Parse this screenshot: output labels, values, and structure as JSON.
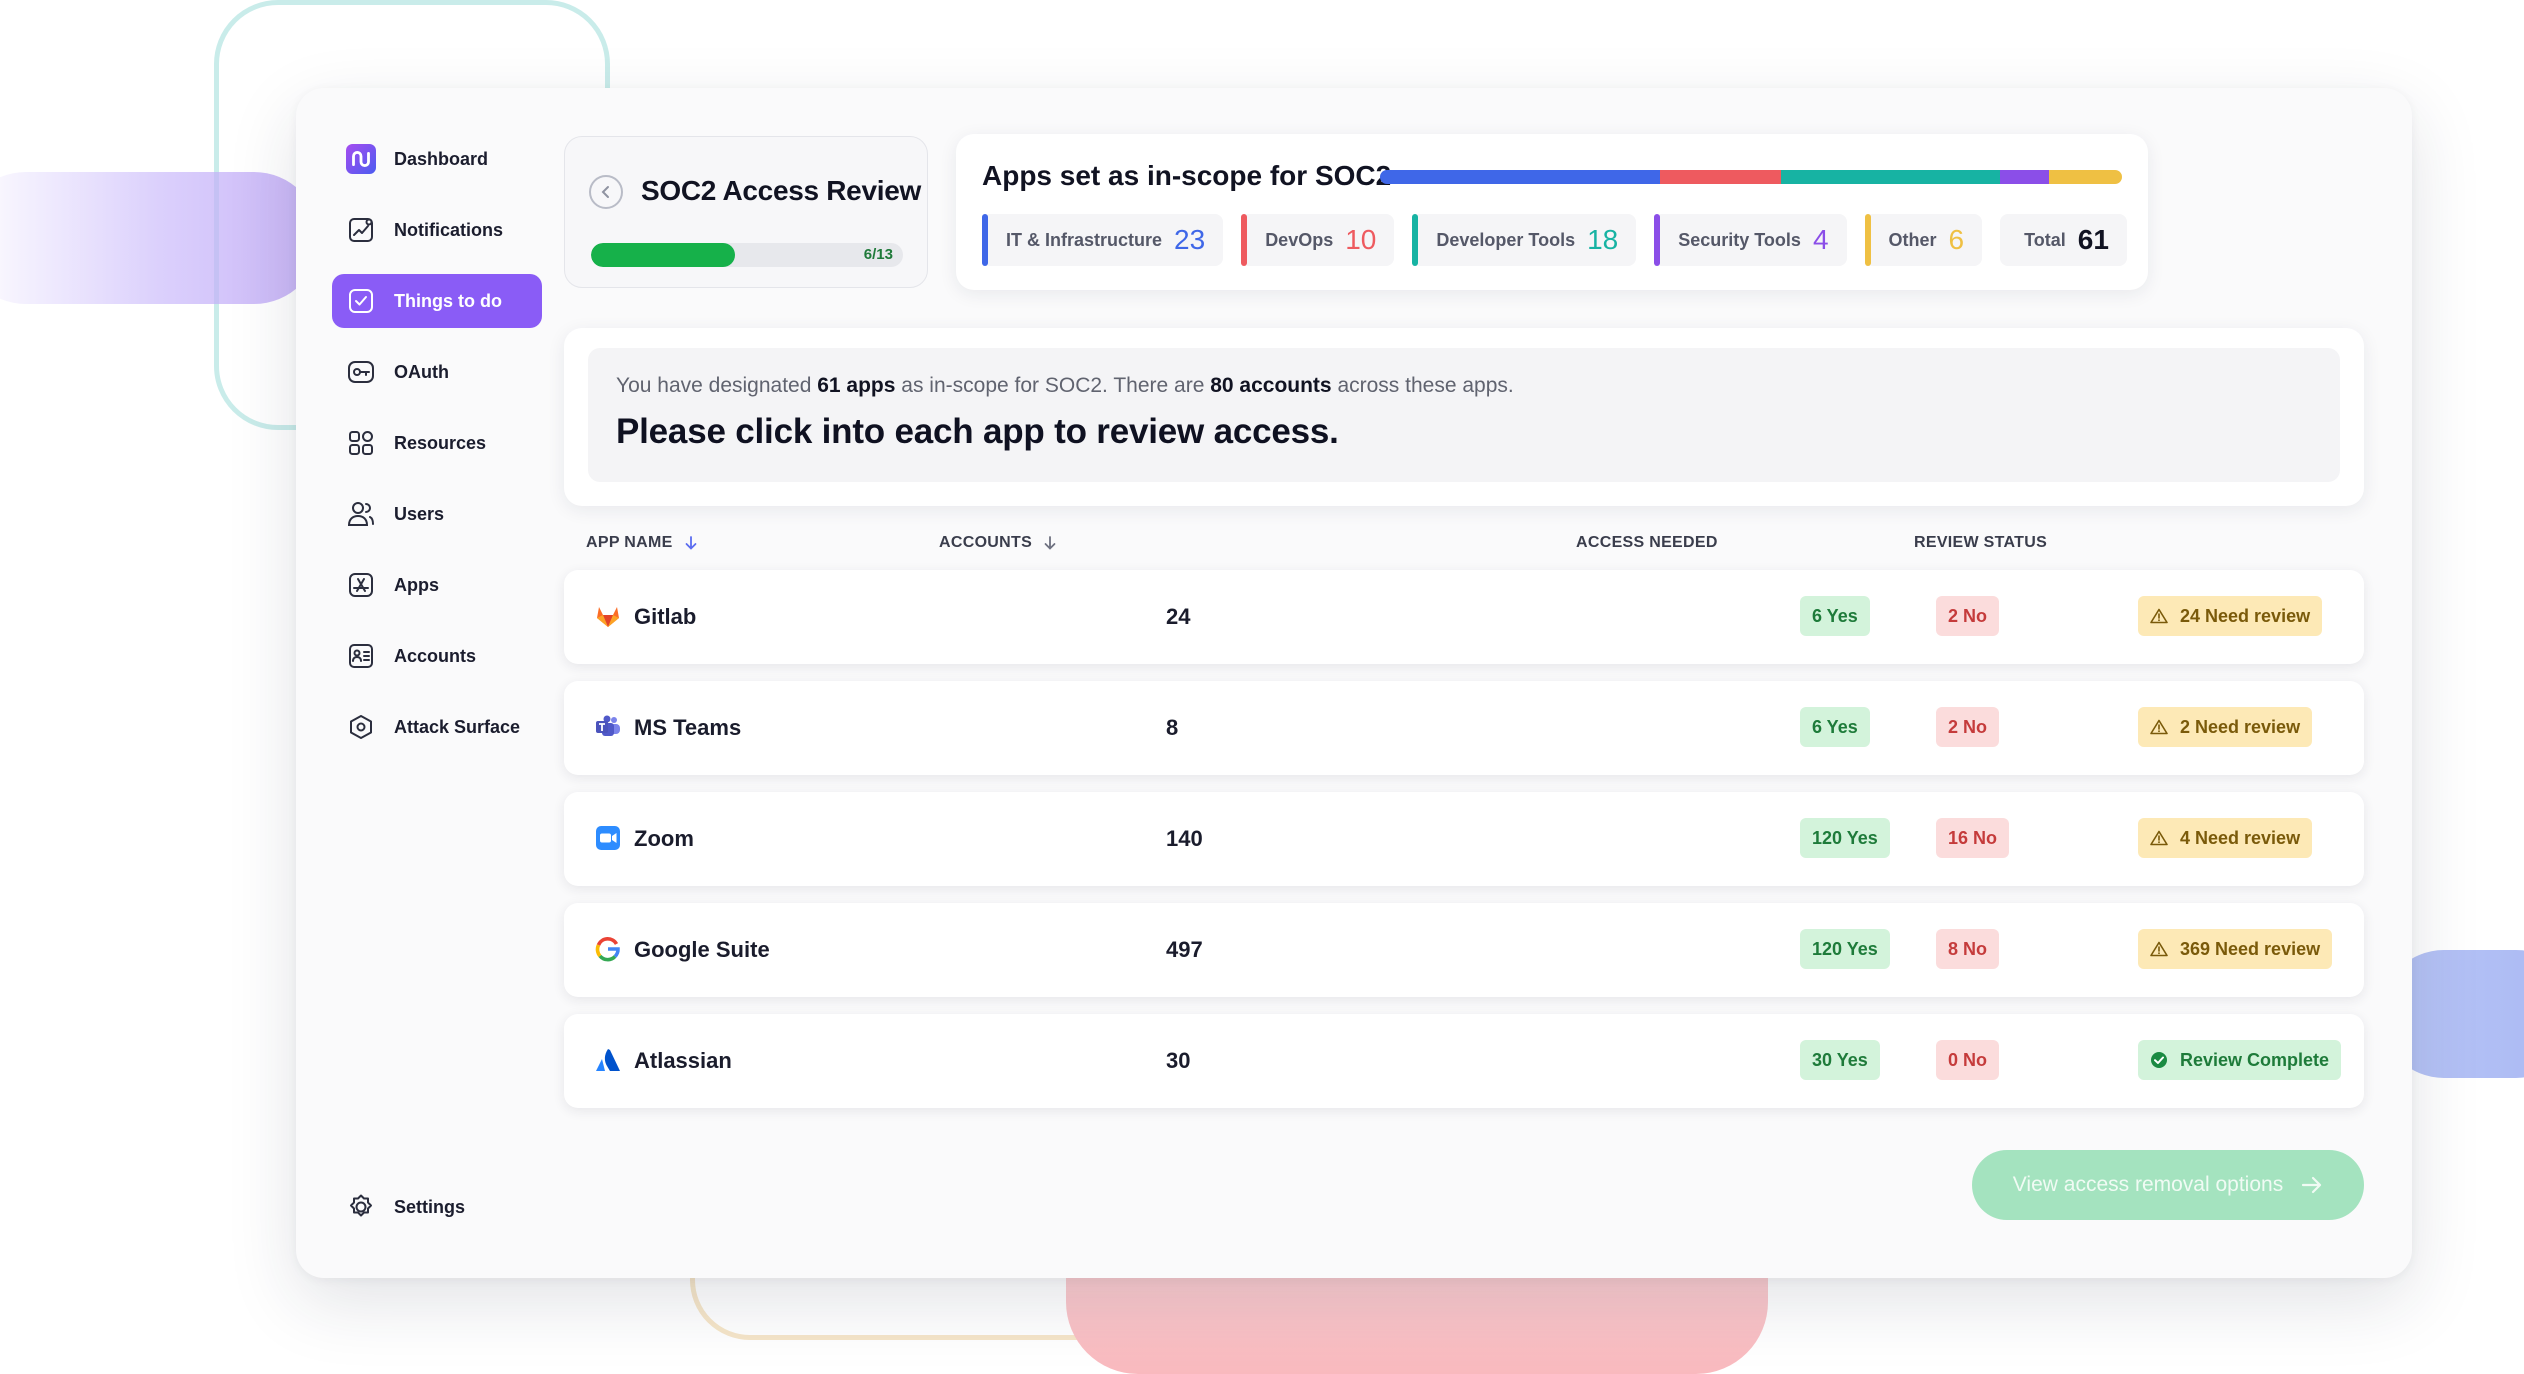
{
  "sidebar": {
    "items": [
      {
        "label": "Dashboard",
        "icon": "logo-icon"
      },
      {
        "label": "Notifications",
        "icon": "chart-line-icon"
      },
      {
        "label": "Things to do",
        "icon": "checkbox-icon",
        "active": true
      },
      {
        "label": "OAuth",
        "icon": "key-icon"
      },
      {
        "label": "Resources",
        "icon": "grid-icon"
      },
      {
        "label": "Users",
        "icon": "users-icon"
      },
      {
        "label": "Apps",
        "icon": "app-store-icon"
      },
      {
        "label": "Accounts",
        "icon": "id-card-icon"
      },
      {
        "label": "Attack Surface",
        "icon": "hexagon-icon"
      }
    ],
    "settings_label": "Settings"
  },
  "review": {
    "title": "SOC2 Access Review",
    "progress_text": "6/13",
    "progress_completed": 6,
    "progress_total": 13
  },
  "scope": {
    "title": "Apps set as in-scope for SOC2",
    "categories": [
      {
        "label": "IT & Infrastructure",
        "count": "23",
        "color": "#3f67e8"
      },
      {
        "label": "DevOps",
        "count": "10",
        "color": "#ee5a5f"
      },
      {
        "label": "Developer Tools",
        "count": "18",
        "color": "#17b3a3"
      },
      {
        "label": "Security Tools",
        "count": "4",
        "color": "#8b4ee8"
      },
      {
        "label": "Other",
        "count": "6",
        "color": "#efc043"
      }
    ],
    "total_label": "Total",
    "total_count": "61"
  },
  "info": {
    "pre1": "You have designated ",
    "apps": "61 apps",
    "mid": " as in-scope for SOC2. There are ",
    "accounts": "80 accounts",
    "post": " across these apps.",
    "headline": "Please click into each app to review access."
  },
  "table": {
    "headers": {
      "app_name": "APP NAME",
      "accounts": "ACCOUNTS",
      "access_needed": "ACCESS NEEDED",
      "review_status": "REVIEW STATUS"
    },
    "rows": [
      {
        "app": "Gitlab",
        "icon": "gitlab-icon",
        "accounts": "24",
        "yes": "6 Yes",
        "no": "2 No",
        "status": "24 Need review",
        "complete": false
      },
      {
        "app": "MS Teams",
        "icon": "ms-teams-icon",
        "accounts": "8",
        "yes": "6 Yes",
        "no": "2 No",
        "status": "2 Need review",
        "complete": false
      },
      {
        "app": "Zoom",
        "icon": "zoom-icon",
        "accounts": "140",
        "yes": "120 Yes",
        "no": "16 No",
        "status": "4 Need review",
        "complete": false
      },
      {
        "app": "Google Suite",
        "icon": "google-icon",
        "accounts": "497",
        "yes": "120 Yes",
        "no": "8 No",
        "status": "369 Need review",
        "complete": false
      },
      {
        "app": "Atlassian",
        "icon": "atlassian-icon",
        "accounts": "30",
        "yes": "30 Yes",
        "no": "0 No",
        "status": "Review Complete",
        "complete": true
      }
    ]
  },
  "cta_label": "View access removal options",
  "colors": {
    "accent": "#8a5cf6",
    "progress": "#16b14a",
    "yes_bg": "#d3f3db",
    "no_bg": "#fbdcdc",
    "warn_bg": "#fde9b6"
  }
}
